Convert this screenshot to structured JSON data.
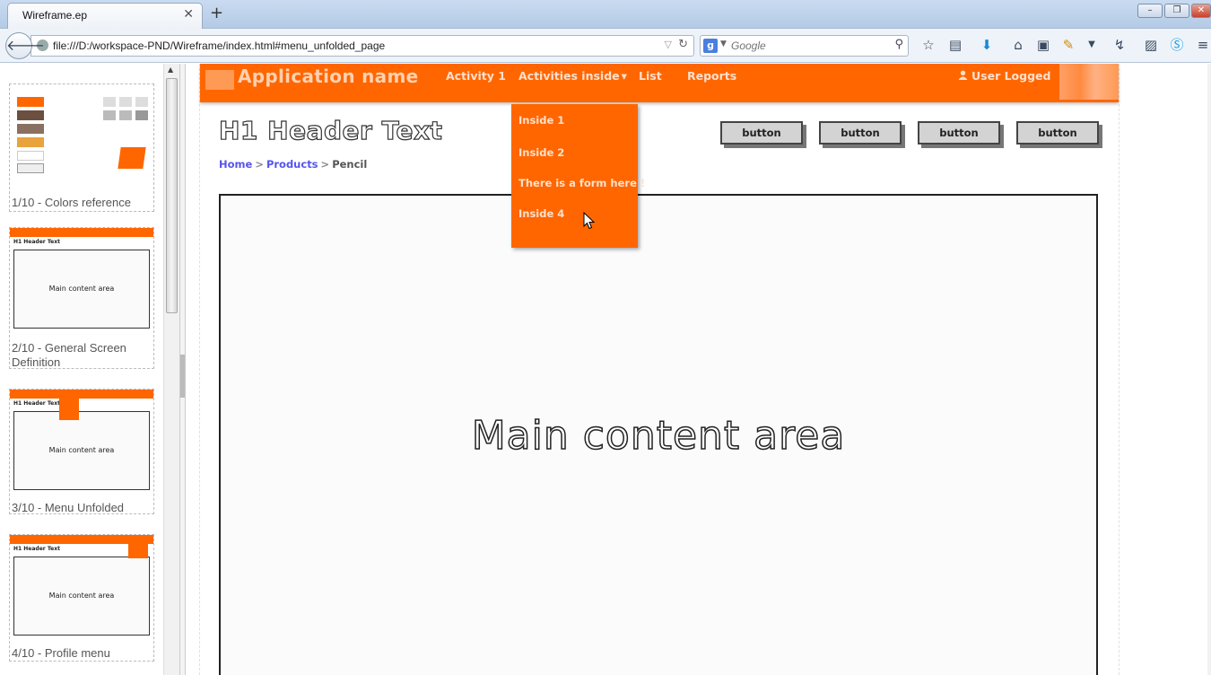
{
  "browser": {
    "tab_title": "Wireframe.ep",
    "tab_close": "✕",
    "new_tab": "+",
    "url": "file:///D:/workspace-PND/Wireframe/index.html#menu_unfolded_page",
    "search_placeholder": "Google",
    "search_engine_letter": "g"
  },
  "sidebar": {
    "thumbs": [
      {
        "caption": "1/10 - Colors reference"
      },
      {
        "caption": "2/10 - General Screen Definition",
        "content_label": "Main content area",
        "h1": "H1 Header Text"
      },
      {
        "caption": "3/10 - Menu Unfolded",
        "content_label": "Main content area",
        "h1": "H1 Header Text"
      },
      {
        "caption": "4/10 - Profile menu",
        "content_label": "Main content area",
        "h1": "H1 Header Text"
      }
    ]
  },
  "app": {
    "name": "Application name",
    "nav": [
      "Activity 1",
      "Activities inside",
      "List",
      "Reports"
    ],
    "user": "User Logged",
    "h1": "H1 Header Text",
    "breadcrumb": {
      "home": "Home",
      "products": "Products",
      "current": "Pencil",
      "sep": ">"
    },
    "buttons": [
      "button",
      "button",
      "button",
      "button"
    ],
    "content_label": "Main content area",
    "dropdown": [
      "Inside 1",
      "Inside 2",
      "There is a form here !",
      "Inside 4"
    ]
  },
  "colors": {
    "accent": "#ff6600",
    "link": "#5555ee",
    "button_bg": "#d3d3d3"
  },
  "icons": [
    "back-arrow-icon",
    "globe-icon",
    "reload-icon",
    "search-icon",
    "bookmark-star-icon",
    "reading-list-icon",
    "download-icon",
    "home-icon",
    "screenshot-icon",
    "extension-icon",
    "menu-icon",
    "user-icon",
    "dropdown-caret-icon",
    "mouse-cursor-icon"
  ]
}
